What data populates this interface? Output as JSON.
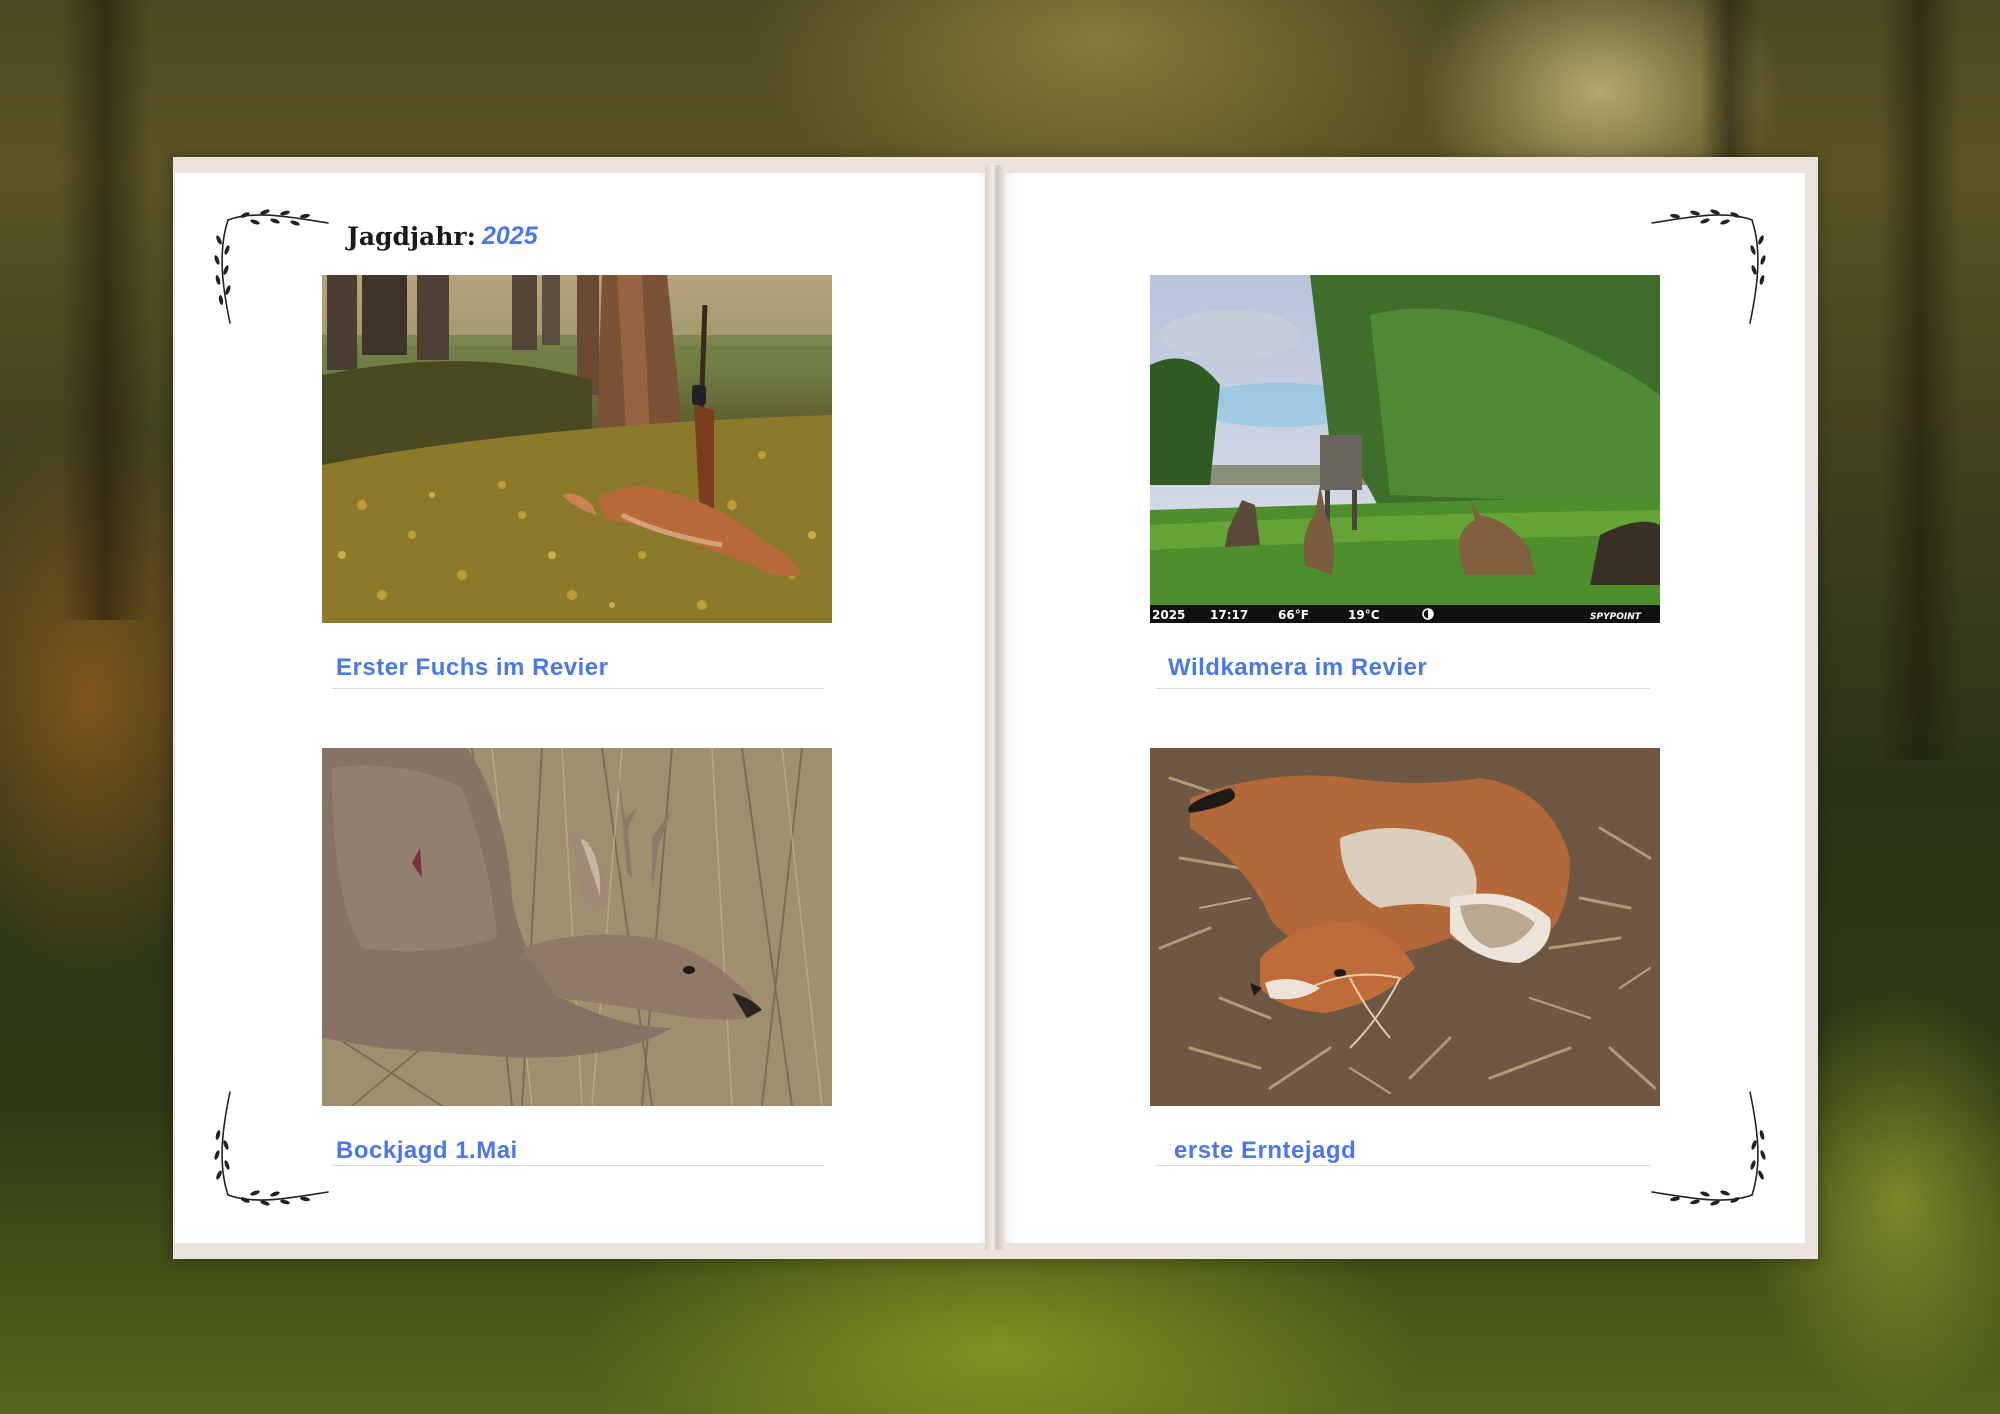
{
  "album": {
    "title_label": "Jagdjahr:",
    "year": "2025"
  },
  "photos": [
    {
      "id": "photo-fox-rifle",
      "caption": "Erster Fuchs im Revier"
    },
    {
      "id": "photo-trail-camera",
      "caption": "Wildkamera im Revier",
      "overlay": {
        "year": "2025",
        "time": "17:17",
        "temp_f": "66°F",
        "temp_c": "19°C",
        "brand": "SPYPOINT"
      }
    },
    {
      "id": "photo-roebuck",
      "caption": "Bockjagd 1.Mai"
    },
    {
      "id": "photo-fox-harvest",
      "caption": "erste Erntejagd"
    }
  ],
  "colors": {
    "accent": "#4a78e8",
    "title": "#1a1a1a",
    "page": "#ffffff"
  },
  "icons": [
    "leaf-flourish-icon"
  ]
}
